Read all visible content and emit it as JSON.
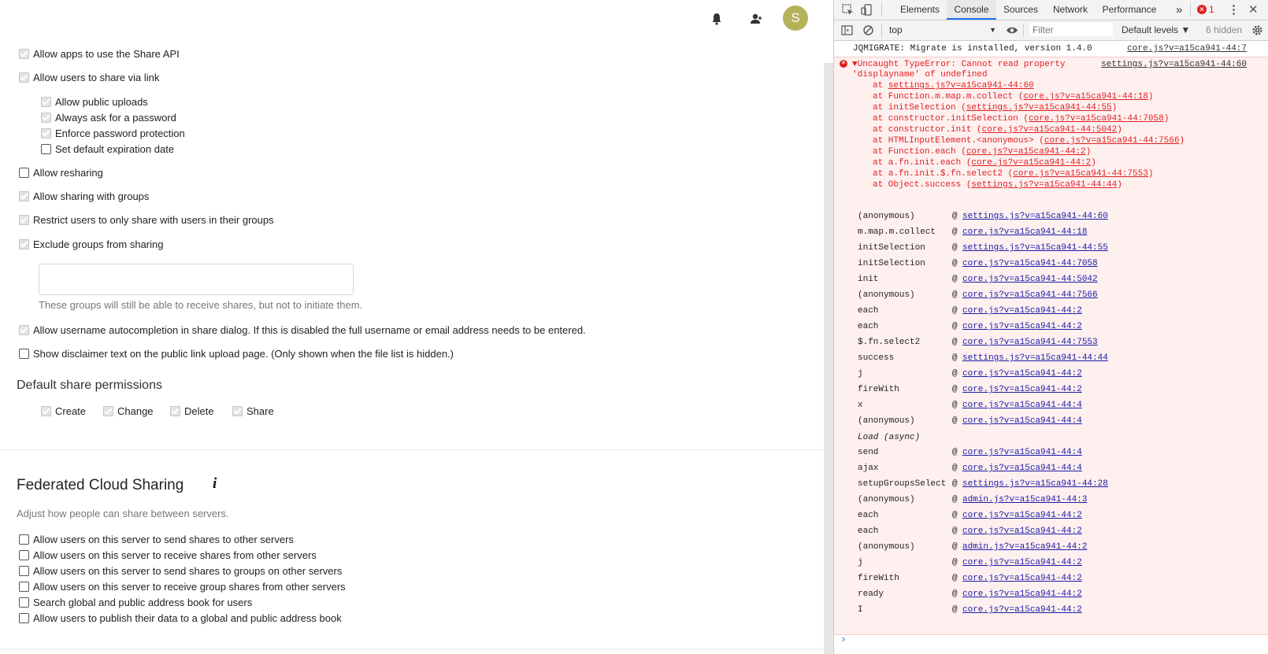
{
  "app": {
    "avatar_letter": "S",
    "icons": [
      "bell-icon",
      "contacts-icon"
    ],
    "share_options": [
      {
        "label": "Allow apps to use the Share API",
        "checked": true
      },
      {
        "label": "Allow users to share via link",
        "checked": true
      },
      {
        "label": "Allow public uploads",
        "checked": true
      },
      {
        "label": "Always ask for a password",
        "checked": true
      },
      {
        "label": "Enforce password protection",
        "checked": true
      },
      {
        "label": "Set default expiration date",
        "checked": false
      },
      {
        "label": "Allow resharing",
        "checked": false
      },
      {
        "label": "Allow sharing with groups",
        "checked": true
      },
      {
        "label": "Restrict users to only share with users in their groups",
        "checked": true
      },
      {
        "label": "Exclude groups from sharing",
        "checked": true
      },
      {
        "label": "Allow username autocompletion in share dialog. If this is disabled the full username or email address needs to be entered.",
        "checked": true
      },
      {
        "label": "Show disclaimer text on the public link upload page. (Only shown when the file list is hidden.)",
        "checked": false
      }
    ],
    "groups_hint": "These groups will still be able to receive shares, but not to initiate them.",
    "default_permissions": {
      "title": "Default share permissions",
      "items": [
        {
          "label": "Create",
          "checked": true
        },
        {
          "label": "Change",
          "checked": true
        },
        {
          "label": "Delete",
          "checked": true
        },
        {
          "label": "Share",
          "checked": true
        }
      ]
    },
    "federated": {
      "title": "Federated Cloud Sharing",
      "info": "i",
      "description": "Adjust how people can share between servers.",
      "options": [
        {
          "label": "Allow users on this server to send shares to other servers",
          "checked": false
        },
        {
          "label": "Allow users on this server to receive shares from other servers",
          "checked": false
        },
        {
          "label": "Allow users on this server to send shares to groups on other servers",
          "checked": false
        },
        {
          "label": "Allow users on this server to receive group shares from other servers",
          "checked": false
        },
        {
          "label": "Search global and public address book for users",
          "checked": false
        },
        {
          "label": "Allow users to publish their data to a global and public address book",
          "checked": false
        }
      ]
    }
  },
  "devtools": {
    "tabs": [
      "Elements",
      "Console",
      "Sources",
      "Network",
      "Performance"
    ],
    "active_tab": "Console",
    "more": "»",
    "error_count": "1",
    "context": "top",
    "filter_placeholder": "Filter",
    "levels": "Default levels ▼",
    "hidden": "6 hidden",
    "log": {
      "text": "JQMIGRATE: Migrate is installed, version 1.4.0",
      "source": "core.js?v=a15ca941-44:7"
    },
    "error": {
      "line1": "▼Uncaught TypeError: Cannot read property",
      "line2": "'displayname' of undefined",
      "source": "settings.js?v=a15ca941-44:60",
      "stack": [
        {
          "pre": "at ",
          "fn": "",
          "link": "settings.js?v=a15ca941-44:60"
        },
        {
          "pre": "at Function.m.map.m.collect (",
          "link": "core.js?v=a15ca941-44:18",
          "post": ")"
        },
        {
          "pre": "at initSelection (",
          "link": "settings.js?v=a15ca941-44:55",
          "post": ")"
        },
        {
          "pre": "at constructor.initSelection (",
          "link": "core.js?v=a15ca941-44:7058",
          "post": ")"
        },
        {
          "pre": "at constructor.init (",
          "link": "core.js?v=a15ca941-44:5042",
          "post": ")"
        },
        {
          "pre": "at HTMLInputElement.<anonymous> (",
          "link": "core.js?v=a15ca941-44:7566",
          "post": ")"
        },
        {
          "pre": "at Function.each (",
          "link": "core.js?v=a15ca941-44:2",
          "post": ")"
        },
        {
          "pre": "at a.fn.init.each (",
          "link": "core.js?v=a15ca941-44:2",
          "post": ")"
        },
        {
          "pre": "at a.fn.init.$.fn.select2 (",
          "link": "core.js?v=a15ca941-44:7553",
          "post": ")"
        },
        {
          "pre": "at Object.success (",
          "link": "settings.js?v=a15ca941-44:44",
          "post": ")"
        }
      ],
      "frames": [
        {
          "fn": "(anonymous)",
          "link": "settings.js?v=a15ca941-44:60"
        },
        {
          "fn": "m.map.m.collect",
          "link": "core.js?v=a15ca941-44:18"
        },
        {
          "fn": "initSelection",
          "link": "settings.js?v=a15ca941-44:55"
        },
        {
          "fn": "initSelection",
          "link": "core.js?v=a15ca941-44:7058"
        },
        {
          "fn": "init",
          "link": "core.js?v=a15ca941-44:5042"
        },
        {
          "fn": "(anonymous)",
          "link": "core.js?v=a15ca941-44:7566"
        },
        {
          "fn": "each",
          "link": "core.js?v=a15ca941-44:2"
        },
        {
          "fn": "each",
          "link": "core.js?v=a15ca941-44:2"
        },
        {
          "fn": "$.fn.select2",
          "link": "core.js?v=a15ca941-44:7553"
        },
        {
          "fn": "success",
          "link": "settings.js?v=a15ca941-44:44"
        },
        {
          "fn": "j",
          "link": "core.js?v=a15ca941-44:2"
        },
        {
          "fn": "fireWith",
          "link": "core.js?v=a15ca941-44:2"
        },
        {
          "fn": "x",
          "link": "core.js?v=a15ca941-44:4"
        },
        {
          "fn": "(anonymous)",
          "link": "core.js?v=a15ca941-44:4"
        },
        {
          "fn": "Load (async)",
          "link": "",
          "italic": true
        },
        {
          "fn": "send",
          "link": "core.js?v=a15ca941-44:4"
        },
        {
          "fn": "ajax",
          "link": "core.js?v=a15ca941-44:4"
        },
        {
          "fn": "setupGroupsSelect",
          "link": "settings.js?v=a15ca941-44:28"
        },
        {
          "fn": "(anonymous)",
          "link": "admin.js?v=a15ca941-44:3"
        },
        {
          "fn": "each",
          "link": "core.js?v=a15ca941-44:2"
        },
        {
          "fn": "each",
          "link": "core.js?v=a15ca941-44:2"
        },
        {
          "fn": "(anonymous)",
          "link": "admin.js?v=a15ca941-44:2"
        },
        {
          "fn": "j",
          "link": "core.js?v=a15ca941-44:2"
        },
        {
          "fn": "fireWith",
          "link": "core.js?v=a15ca941-44:2"
        },
        {
          "fn": "ready",
          "link": "core.js?v=a15ca941-44:2"
        },
        {
          "fn": "I",
          "link": "core.js?v=a15ca941-44:2"
        }
      ]
    },
    "prompt": "›"
  }
}
